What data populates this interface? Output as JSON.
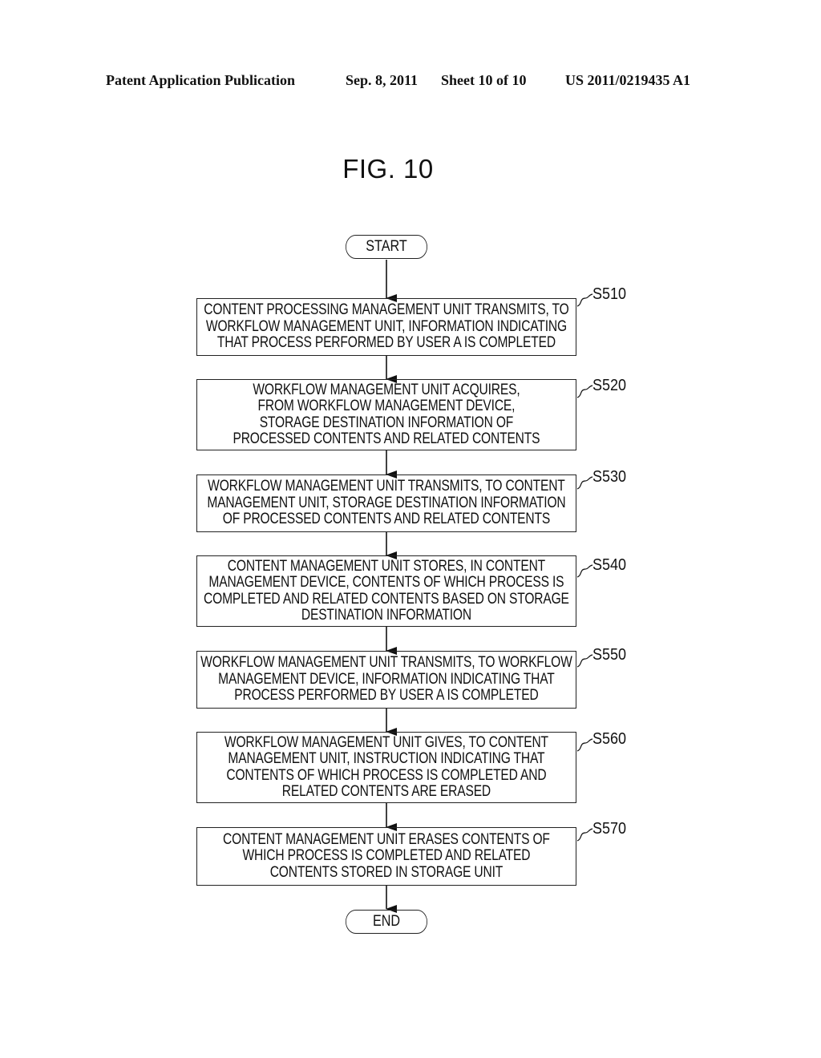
{
  "header": {
    "publication": "Patent Application Publication",
    "date": "Sep. 8, 2011",
    "sheet": "Sheet 10 of 10",
    "number": "US 2011/0219435 A1"
  },
  "figure": {
    "title": "FIG. 10",
    "start_label": "START",
    "end_label": "END",
    "steps": [
      {
        "id": "S510",
        "text": "CONTENT PROCESSING MANAGEMENT UNIT TRANSMITS, TO\nWORKFLOW MANAGEMENT UNIT, INFORMATION INDICATING\nTHAT PROCESS PERFORMED BY USER A IS COMPLETED"
      },
      {
        "id": "S520",
        "text": "WORKFLOW MANAGEMENT UNIT ACQUIRES,\nFROM WORKFLOW MANAGEMENT DEVICE,\nSTORAGE DESTINATION INFORMATION OF\nPROCESSED CONTENTS AND RELATED CONTENTS"
      },
      {
        "id": "S530",
        "text": "WORKFLOW MANAGEMENT UNIT TRANSMITS, TO CONTENT\nMANAGEMENT UNIT, STORAGE DESTINATION INFORMATION\nOF PROCESSED CONTENTS AND RELATED CONTENTS"
      },
      {
        "id": "S540",
        "text": "CONTENT MANAGEMENT UNIT STORES, IN CONTENT\nMANAGEMENT DEVICE, CONTENTS OF WHICH PROCESS IS\nCOMPLETED AND RELATED CONTENTS BASED ON STORAGE\nDESTINATION INFORMATION"
      },
      {
        "id": "S550",
        "text": "WORKFLOW MANAGEMENT UNIT TRANSMITS, TO WORKFLOW\nMANAGEMENT DEVICE, INFORMATION INDICATING THAT\nPROCESS PERFORMED BY USER A IS COMPLETED"
      },
      {
        "id": "S560",
        "text": "WORKFLOW MANAGEMENT UNIT GIVES, TO CONTENT\nMANAGEMENT UNIT, INSTRUCTION INDICATING THAT\nCONTENTS OF WHICH PROCESS IS COMPLETED AND\nRELATED CONTENTS ARE ERASED"
      },
      {
        "id": "S570",
        "text": "CONTENT MANAGEMENT UNIT ERASES CONTENTS OF\nWHICH PROCESS IS COMPLETED AND RELATED\nCONTENTS STORED IN STORAGE UNIT"
      }
    ]
  }
}
